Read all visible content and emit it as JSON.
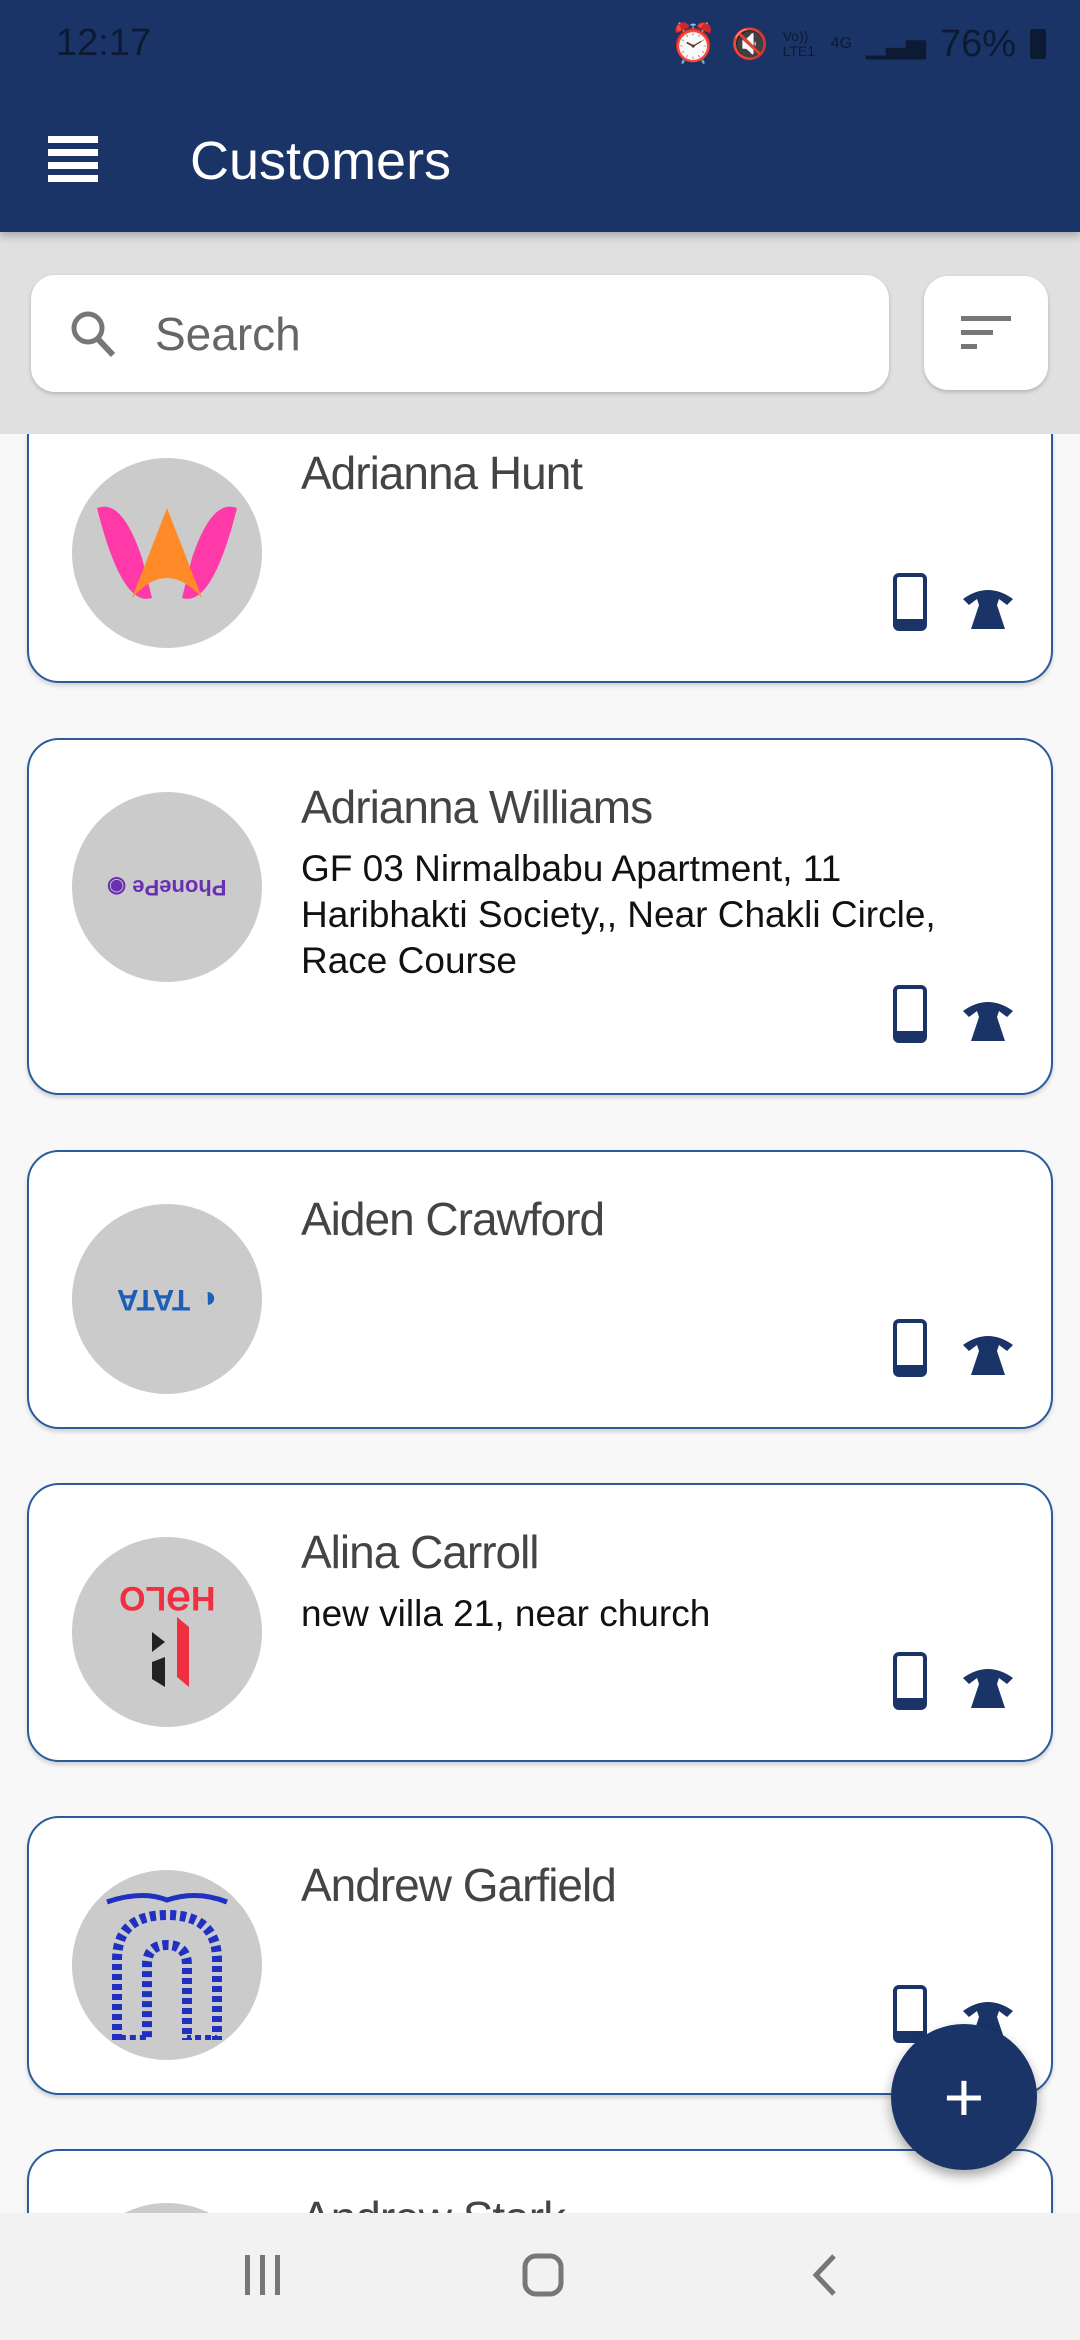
{
  "status_bar": {
    "time": "12:17",
    "battery": "76%",
    "icons": [
      "image-icon",
      "download-icon",
      "alarm-icon",
      "mute-vibrate-icon",
      "volte-icon",
      "4g-icon",
      "signal-icon",
      "battery-icon"
    ],
    "network_label": "Vo)) LTE1",
    "data_label": "4G"
  },
  "app_bar": {
    "title": "Customers",
    "menu_icon": "hamburger-menu-icon"
  },
  "search": {
    "placeholder": "Search",
    "value": ""
  },
  "colors": {
    "primary": "#1a3468",
    "card_border": "#2a5b9c",
    "search_area": "#e0e0e0"
  },
  "customers": [
    {
      "name": "Adrianna Hunt",
      "address": "",
      "logo": "W logo"
    },
    {
      "name": "Adrianna Williams",
      "address": "GF 03 Nirmalbabu Apartment, 11 Haribhakti Society,, Near Chakli Circle, Race Course",
      "logo": "PhonePe"
    },
    {
      "name": "Aiden Crawford",
      "address": "",
      "logo": "TATA"
    },
    {
      "name": "Alina Carroll",
      "address": "new villa 21, near church",
      "logo": "HELO"
    },
    {
      "name": "Andrew Garfield",
      "address": "",
      "logo": "blue arch logo"
    },
    {
      "name": "Andrew Stark",
      "address": "",
      "logo": ""
    }
  ],
  "fab": {
    "label": "+"
  }
}
